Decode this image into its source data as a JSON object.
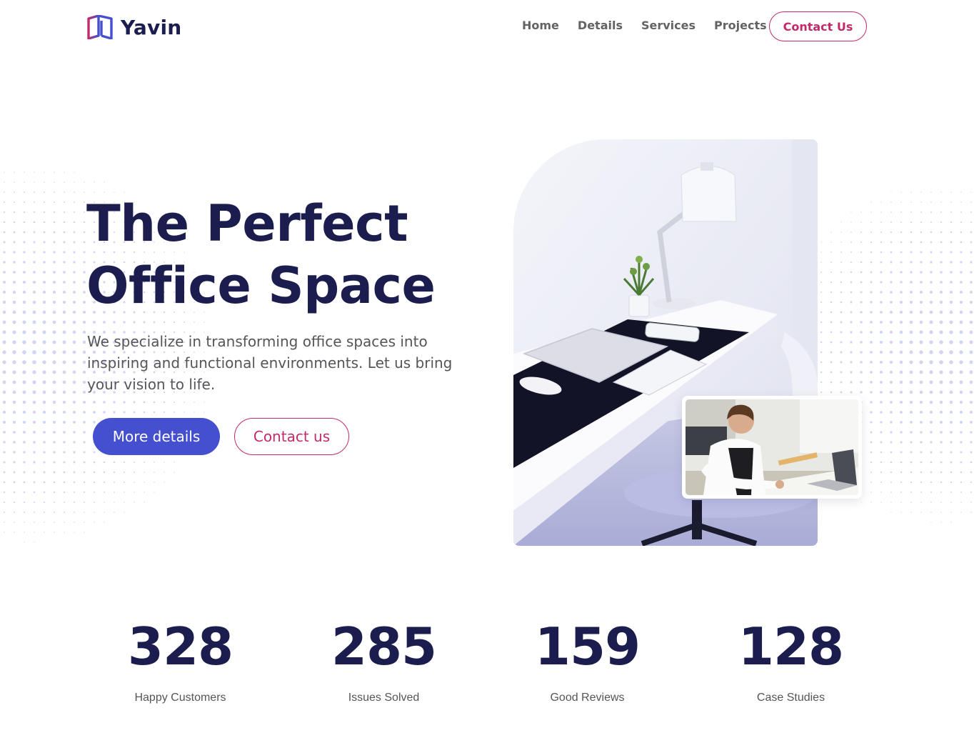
{
  "brand": {
    "name": "Yavin",
    "logo_icon": "open-book-icon"
  },
  "nav": {
    "items": [
      {
        "label": "Home"
      },
      {
        "label": "Details"
      },
      {
        "label": "Services"
      },
      {
        "label": "Projects"
      }
    ],
    "cta_label": "Contact Us"
  },
  "hero": {
    "title_line1": "The Perfect",
    "title_line2": "Office Space",
    "subtitle": "We specialize in transforming office spaces into inspiring and functional environments. Let us bring your vision to life.",
    "primary_button": "More details",
    "secondary_button": "Contact us"
  },
  "stats": [
    {
      "value": "328",
      "label": "Happy Customers"
    },
    {
      "value": "285",
      "label": "Issues Solved"
    },
    {
      "value": "159",
      "label": "Good Reviews"
    },
    {
      "value": "128",
      "label": "Case Studies"
    }
  ],
  "colors": {
    "navy": "#1b1d4e",
    "accent_blue": "#4450cf",
    "accent_pink": "#c22a6b",
    "text_gray": "#55555a"
  }
}
